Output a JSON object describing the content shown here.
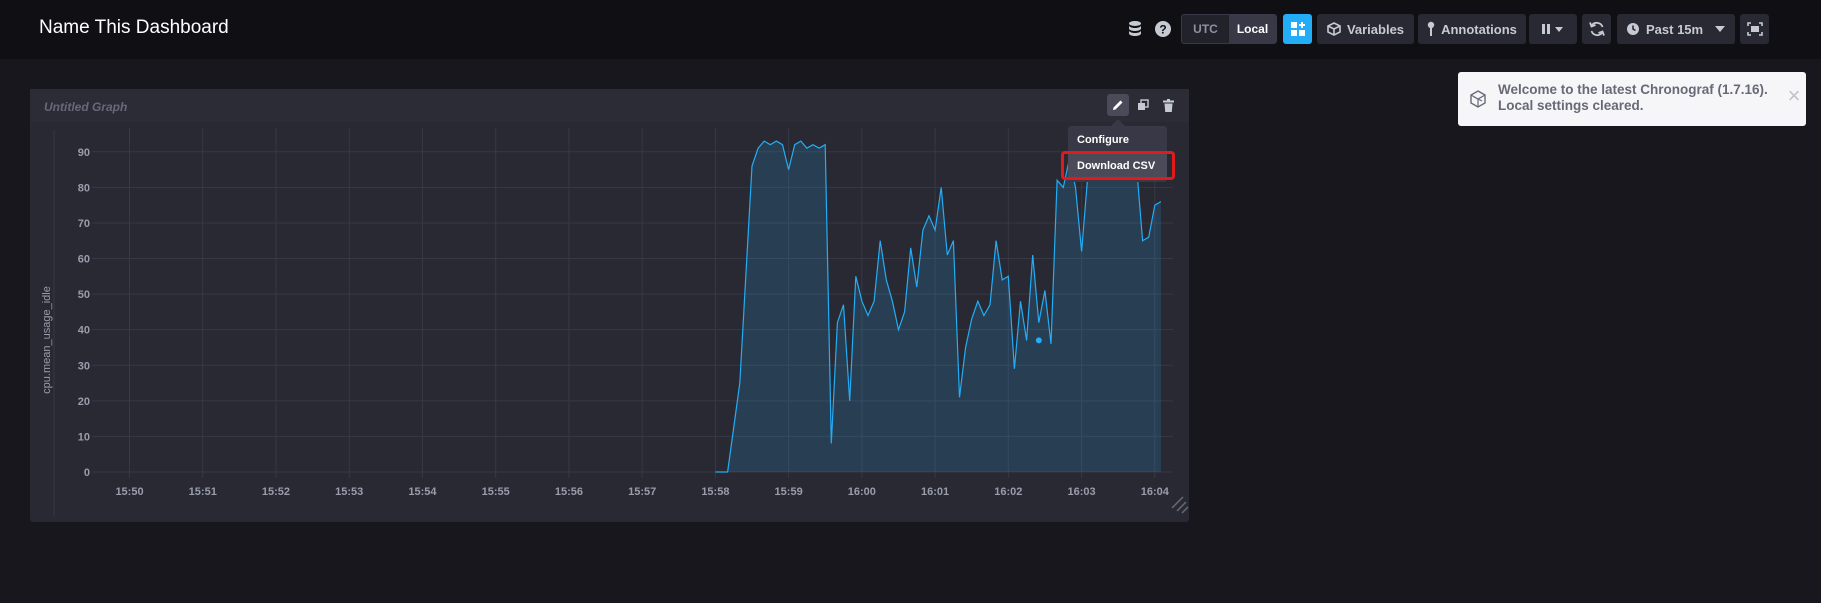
{
  "header": {
    "title": "Name This Dashboard",
    "timezone": {
      "options": [
        "UTC",
        "Local"
      ],
      "selected": "Local"
    },
    "variables_label": "Variables",
    "annotations_label": "Annotations",
    "time_range_label": "Past 15m",
    "icons": [
      "database-icon",
      "help-icon",
      "add-cell-icon",
      "cube-icon",
      "annotation-pin-icon",
      "pause-icon",
      "refresh-icon",
      "clock-icon",
      "fullscreen-icon"
    ]
  },
  "cell": {
    "title": "Untitled Graph",
    "menu": {
      "configure_label": "Configure",
      "download_label": "Download CSV"
    }
  },
  "toast": {
    "message": "Welcome to the latest Chronograf (1.7.16). Local settings cleared."
  },
  "colors": {
    "line": "#22ADF6",
    "accent": "#22ADF6",
    "highlight": "#E11B1B"
  },
  "chart_data": {
    "type": "area",
    "ylabel": "cpu.mean_usage_idle",
    "ylim": [
      0,
      95
    ],
    "yticks": [
      0,
      10,
      20,
      30,
      40,
      50,
      60,
      70,
      80,
      90
    ],
    "xlim": [
      "15:49:35",
      "16:04:10"
    ],
    "xticks": [
      "15:50",
      "15:51",
      "15:52",
      "15:53",
      "15:54",
      "15:55",
      "15:56",
      "15:57",
      "15:58",
      "15:59",
      "16:00",
      "16:01",
      "16:02",
      "16:03",
      "16:04"
    ],
    "series": [
      {
        "x": [
          "15:58:00",
          "15:58:10",
          "15:58:20",
          "15:58:30",
          "15:58:35",
          "15:58:40",
          "15:58:45",
          "15:58:50",
          "15:58:55",
          "15:59:00",
          "15:59:05",
          "15:59:10",
          "15:59:15",
          "15:59:20",
          "15:59:25",
          "15:59:30",
          "15:59:35",
          "15:59:40",
          "15:59:45",
          "15:59:50",
          "15:59:55",
          "16:00:00",
          "16:00:05",
          "16:00:10",
          "16:00:15",
          "16:00:20",
          "16:00:25",
          "16:00:30",
          "16:00:35",
          "16:00:40",
          "16:00:45",
          "16:00:50",
          "16:00:55",
          "16:01:00",
          "16:01:05",
          "16:01:10",
          "16:01:15",
          "16:01:20",
          "16:01:25",
          "16:01:30",
          "16:01:35",
          "16:01:40",
          "16:01:45",
          "16:01:50",
          "16:01:55",
          "16:02:00",
          "16:02:05",
          "16:02:10",
          "16:02:15",
          "16:02:20",
          "16:02:25",
          "16:02:30",
          "16:02:35",
          "16:02:40",
          "16:02:45",
          "16:02:50",
          "16:02:55",
          "16:03:00",
          "16:03:05",
          "16:03:10",
          "16:03:15",
          "16:03:20",
          "16:03:25",
          "16:03:30",
          "16:03:35",
          "16:03:40",
          "16:03:45",
          "16:03:50",
          "16:03:55",
          "16:04:00",
          "16:04:05"
        ],
        "y": [
          0,
          0,
          25,
          86,
          91,
          93,
          92,
          93,
          92,
          85,
          92,
          93,
          91,
          92,
          91,
          92,
          8,
          42,
          47,
          20,
          55,
          48,
          44,
          48,
          65,
          54,
          48,
          40,
          45,
          63,
          52,
          68,
          72,
          68,
          80,
          61,
          65,
          21,
          35,
          43,
          48,
          44,
          47,
          65,
          54,
          55,
          29,
          48,
          37,
          61,
          42,
          51,
          36,
          82,
          80,
          88,
          80,
          62,
          83,
          89,
          88,
          90,
          86,
          85,
          90,
          88,
          86,
          65,
          66,
          75,
          76
        ],
        "marker": {
          "x": "16:02:25",
          "y": 37
        }
      }
    ],
    "grid": true
  }
}
